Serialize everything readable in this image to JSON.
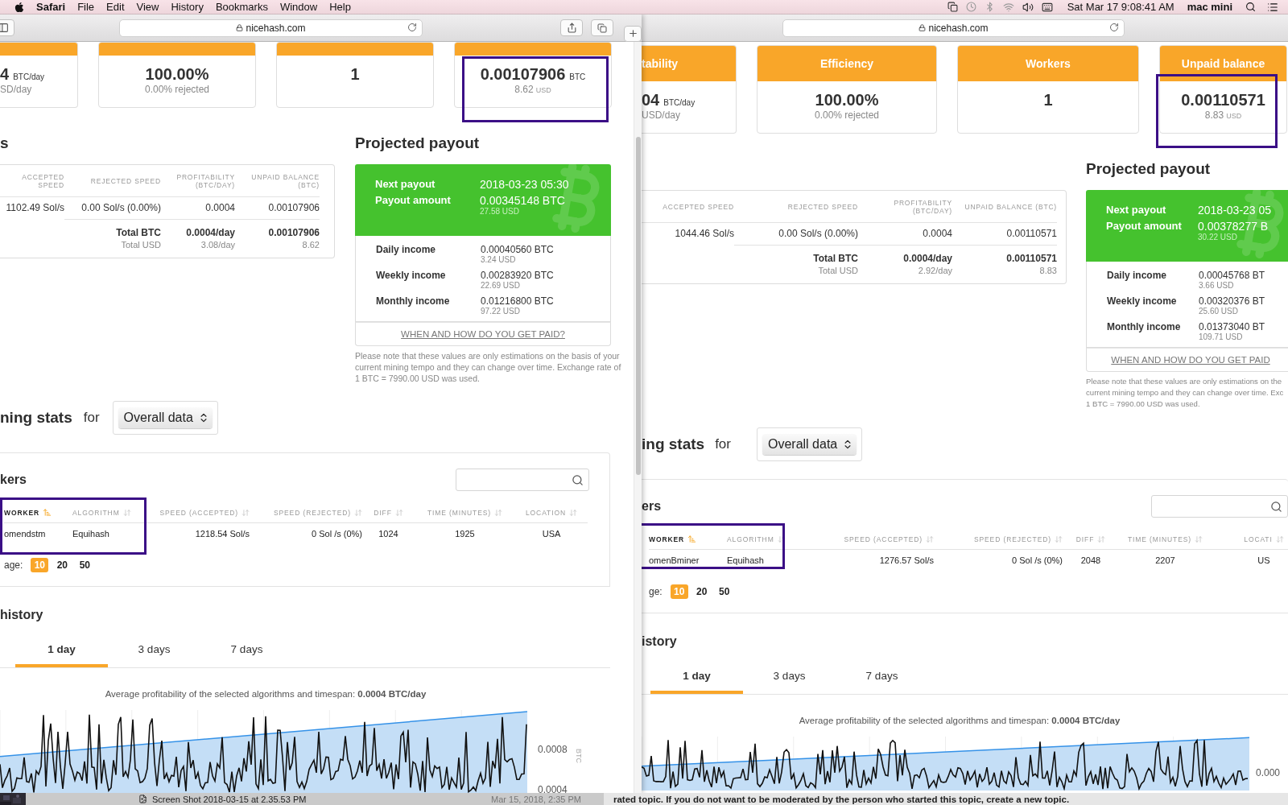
{
  "menubar": {
    "app": "Safari",
    "menus": [
      "File",
      "Edit",
      "View",
      "History",
      "Bookmarks",
      "Window",
      "Help"
    ],
    "clock": "Sat Mar 17  9:08:41 AM",
    "user": "mac mini"
  },
  "windows": [
    {
      "address": "nicehash.com",
      "stat_cards": [
        {
          "value": "4",
          "unit": "BTC/day",
          "sub": "SD/day",
          "highlighted": false
        },
        {
          "value": "100.00%",
          "sub": "0.00% rejected",
          "highlighted": false
        },
        {
          "value": "1",
          "highlighted": false
        },
        {
          "value": "0.00107906",
          "unit": "BTC",
          "sub": "8.62",
          "sub_unit": "USD",
          "highlighted": true
        }
      ],
      "summary": {
        "heading": "s",
        "columns": [
          "ACCEPTED SPEED",
          "REJECTED SPEED",
          "PROFITABILITY (BTC/DAY)",
          "UNPAID BALANCE (BTC)"
        ],
        "row": [
          "1102.49 Sol/s",
          "0.00 Sol/s (0.00%)",
          "0.0004",
          "0.00107906"
        ],
        "totals": [
          {
            "kind": "btc",
            "label": "Total BTC",
            "values": [
              "0.0004/day",
              "0.00107906"
            ]
          },
          {
            "kind": "usd",
            "label": "Total USD",
            "values": [
              "3.08/day",
              "8.62"
            ]
          }
        ]
      },
      "payout": {
        "heading": "Projected payout",
        "next_label": "Next payout",
        "next_value": "2018-03-23 05:30",
        "amount_label": "Payout amount",
        "amount_value": "0.00345148 BTC",
        "amount_usd": "27.58 USD",
        "incomes": [
          {
            "label": "Daily income",
            "btc": "0.00040560 BTC",
            "usd": "3.24 USD"
          },
          {
            "label": "Weekly income",
            "btc": "0.00283920 BTC",
            "usd": "22.69 USD"
          },
          {
            "label": "Monthly income",
            "btc": "0.01216800 BTC",
            "usd": "97.22 USD"
          }
        ],
        "link": "WHEN AND HOW DO YOU GET PAID?",
        "note_lines": [
          "Please note that these values are only estimations on the basis of your",
          "current mining tempo and they can change over time. Exchange rate of",
          "1 BTC = 7990.00 USD was used."
        ]
      },
      "stats": {
        "title": "ning stats",
        "for": "for",
        "select": "Overall data"
      },
      "workers": {
        "heading": "kers",
        "highlighted": true,
        "columns": [
          {
            "label": "WORKER",
            "sorted": true
          },
          {
            "label": "ALGORITHM",
            "sorted": false
          },
          {
            "label": "SPEED (ACCEPTED)",
            "sorted": false
          },
          {
            "label": "SPEED (REJECTED)",
            "sorted": false
          },
          {
            "label": "DIFF",
            "sorted": false
          },
          {
            "label": "TIME (MINUTES)",
            "sorted": false
          },
          {
            "label": "LOCATION",
            "sorted": false
          }
        ],
        "rows": [
          [
            "omendstm",
            "Equihash",
            "1218.54 Sol/s",
            "0 Sol /s (0%)",
            "1024",
            "1925",
            "USA"
          ]
        ],
        "per_page_label": "age:",
        "page_sizes": [
          {
            "label": "10",
            "selected": true
          },
          {
            "label": "20",
            "selected": false
          },
          {
            "label": "50",
            "selected": false
          }
        ]
      },
      "history": {
        "heading": "history",
        "tabs": [
          {
            "label": "1 day",
            "selected": true
          },
          {
            "label": "3 days",
            "selected": false
          },
          {
            "label": "7 days",
            "selected": false
          }
        ],
        "average_text": "Average profitability of the selected algorithms and timespan: **0.0004 BTC/day**",
        "y_ticks": [
          "0.0008",
          "0.0004"
        ],
        "y_unit": "BTC"
      }
    },
    {
      "address": "nicehash.com",
      "stat_cards": [
        {
          "title": "tability",
          "value": "04",
          "unit": "BTC/day",
          "sub": "USD/day",
          "highlighted": false
        },
        {
          "title": "Efficiency",
          "value": "100.00%",
          "sub": "0.00% rejected",
          "highlighted": false
        },
        {
          "title": "Workers",
          "value": "1",
          "highlighted": false
        },
        {
          "title": "Unpaid balance",
          "value": "0.00110571",
          "sub": "8.83",
          "sub_unit": "USD",
          "highlighted": true
        }
      ],
      "summary": {
        "columns": [
          "ACCEPTED SPEED",
          "REJECTED SPEED",
          "PROFITABILITY (BTC/DAY)",
          "UNPAID BALANCE (BTC)"
        ],
        "row": [
          "1044.46 Sol/s",
          "0.00 Sol/s (0.00%)",
          "0.0004",
          "0.00110571"
        ],
        "totals": [
          {
            "kind": "btc",
            "label": "Total BTC",
            "values": [
              "0.0004/day",
              "0.00110571"
            ]
          },
          {
            "kind": "usd",
            "label": "Total USD",
            "values": [
              "2.92/day",
              "8.83"
            ]
          }
        ]
      },
      "payout": {
        "heading": "Projected payout",
        "next_label": "Next payout",
        "next_value": "2018-03-23 05",
        "amount_label": "Payout amount",
        "amount_value": "0.00378277 B",
        "amount_usd": "30.22 USD",
        "incomes": [
          {
            "label": "Daily income",
            "btc": "0.00045768 BT",
            "usd": "3.66 USD"
          },
          {
            "label": "Weekly income",
            "btc": "0.00320376 BT",
            "usd": "25.60 USD"
          },
          {
            "label": "Monthly income",
            "btc": "0.01373040 BT",
            "usd": "109.71 USD"
          }
        ],
        "link": "WHEN AND HOW DO YOU GET PAID",
        "note_lines": [
          "Please note that these values are only estimations on the",
          "current mining tempo and they can change over time. Exc",
          "1 BTC = 7990.00 USD was used."
        ]
      },
      "stats": {
        "title": "ing stats",
        "for": "for",
        "select": "Overall data"
      },
      "workers": {
        "heading": "ers",
        "highlighted": true,
        "columns": [
          {
            "label": "WORKER",
            "sorted": true
          },
          {
            "label": "ALGORITHM",
            "sorted": false
          },
          {
            "label": "SPEED (ACCEPTED)",
            "sorted": false
          },
          {
            "label": "SPEED (REJECTED)",
            "sorted": false
          },
          {
            "label": "DIFF",
            "sorted": false
          },
          {
            "label": "TIME (MINUTES)",
            "sorted": false
          },
          {
            "label": "LOCATI",
            "sorted": false
          }
        ],
        "rows": [
          [
            "omenBminer",
            "Equihash",
            "1276.57 Sol/s",
            "0 Sol /s (0%)",
            "2048",
            "2207",
            "US"
          ]
        ],
        "per_page_label": "ge:",
        "page_sizes": [
          {
            "label": "10",
            "selected": true
          },
          {
            "label": "20",
            "selected": false
          },
          {
            "label": "50",
            "selected": false
          }
        ]
      },
      "history": {
        "heading": "istory",
        "tabs": [
          {
            "label": "1 day",
            "selected": true
          },
          {
            "label": "3 days",
            "selected": false
          },
          {
            "label": "7 days",
            "selected": false
          }
        ],
        "average_text": "Average profitability of the selected algorithms and timespan: **0.0004 BTC/day**",
        "y_ticks": [
          "0.000"
        ]
      }
    }
  ],
  "background": {
    "file_name": "Screen Shot 2018-03-15 at 2.35.53 PM",
    "file_date": "Mar 15, 2018, 2:35 PM",
    "forum_text": "rated topic. If you do not want to be moderated by the person who started this topic, create a new topic."
  }
}
